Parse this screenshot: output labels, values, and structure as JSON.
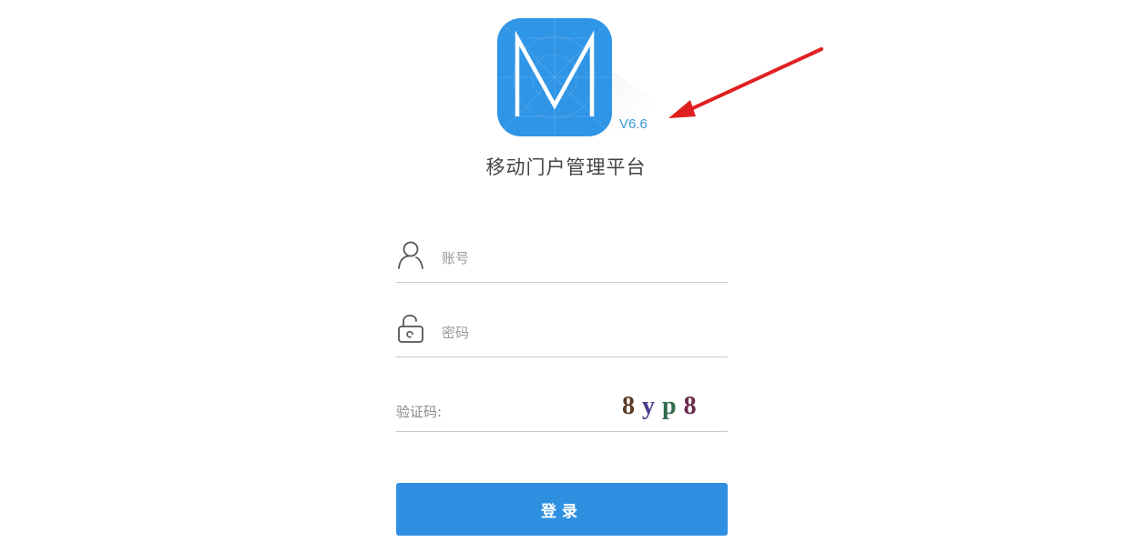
{
  "app": {
    "title": "移动门户管理平台",
    "version": "V6.6",
    "logo_letter": "M"
  },
  "form": {
    "account_placeholder": "账号",
    "password_placeholder": "密码",
    "captcha_label": "验证码:",
    "captcha_chars": [
      "8",
      "y",
      "p",
      "8"
    ],
    "captcha_colors": [
      "#5a3a22",
      "#4a3a8c",
      "#2f6b4a",
      "#6a2a4a"
    ],
    "login_label": "登录"
  },
  "annotation": {
    "arrow_color": "#e02020"
  },
  "colors": {
    "accent": "#2f90e2",
    "logo": "#2f95e6"
  },
  "icons": {
    "account": "user-icon",
    "password": "unlock-icon"
  }
}
